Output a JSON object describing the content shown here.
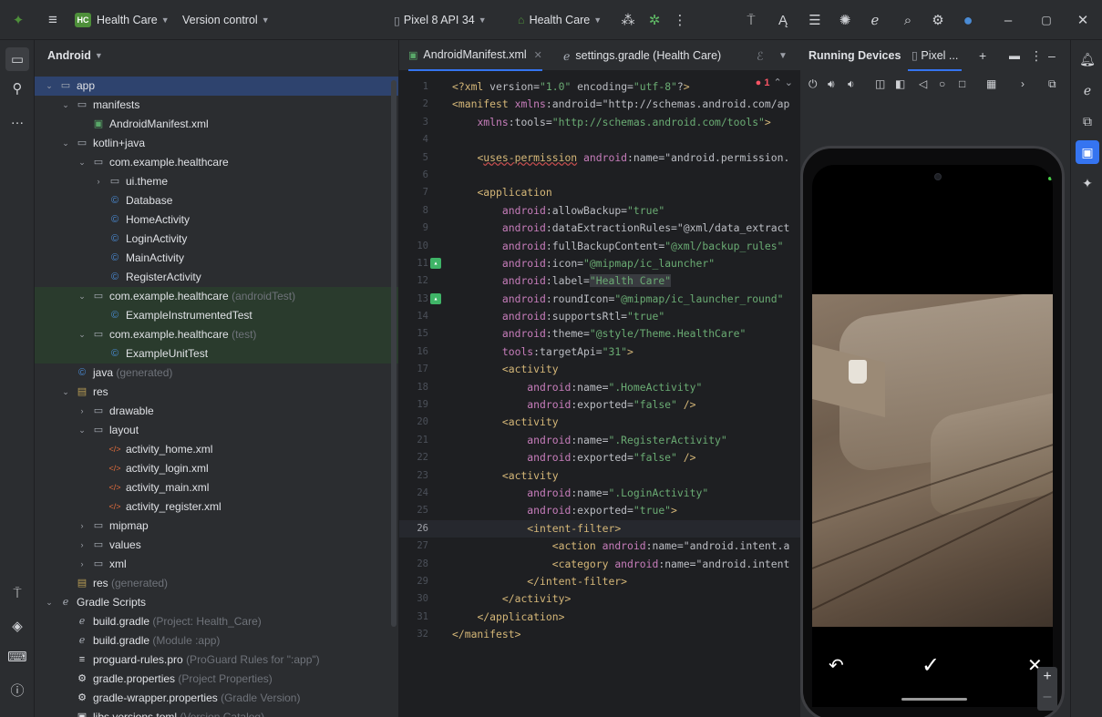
{
  "titlebar": {
    "project_badge": "HC",
    "project_name": "Health Care",
    "vcs": "Version control",
    "device": "Pixel 8 API 34",
    "run_config": "Health Care"
  },
  "project_panel": {
    "view": "Android",
    "tree": [
      {
        "depth": 0,
        "chev": "down",
        "icon": "folder",
        "label": "app",
        "hint": "",
        "selected": true
      },
      {
        "depth": 1,
        "chev": "down",
        "icon": "folder",
        "label": "manifests",
        "hint": ""
      },
      {
        "depth": 2,
        "chev": "",
        "icon": "mani",
        "label": "AndroidManifest.xml",
        "hint": ""
      },
      {
        "depth": 1,
        "chev": "down",
        "icon": "folder",
        "label": "kotlin+java",
        "hint": ""
      },
      {
        "depth": 2,
        "chev": "down",
        "icon": "folder",
        "label": "com.example.healthcare",
        "hint": ""
      },
      {
        "depth": 3,
        "chev": "right",
        "icon": "folder",
        "label": "ui.theme",
        "hint": ""
      },
      {
        "depth": 3,
        "chev": "",
        "icon": "java",
        "label": "Database",
        "hint": ""
      },
      {
        "depth": 3,
        "chev": "",
        "icon": "java",
        "label": "HomeActivity",
        "hint": ""
      },
      {
        "depth": 3,
        "chev": "",
        "icon": "java",
        "label": "LoginActivity",
        "hint": ""
      },
      {
        "depth": 3,
        "chev": "",
        "icon": "java",
        "label": "MainActivity",
        "hint": ""
      },
      {
        "depth": 3,
        "chev": "",
        "icon": "java",
        "label": "RegisterActivity",
        "hint": ""
      },
      {
        "depth": 2,
        "chev": "down",
        "icon": "folder",
        "label": "com.example.healthcare",
        "hint": "(androidTest)",
        "green": true
      },
      {
        "depth": 3,
        "chev": "",
        "icon": "java",
        "label": "ExampleInstrumentedTest",
        "hint": "",
        "green": true
      },
      {
        "depth": 2,
        "chev": "down",
        "icon": "folder",
        "label": "com.example.healthcare",
        "hint": "(test)",
        "green": true
      },
      {
        "depth": 3,
        "chev": "",
        "icon": "java",
        "label": "ExampleUnitTest",
        "hint": "",
        "green": true
      },
      {
        "depth": 1,
        "chev": "",
        "icon": "java",
        "label": "java",
        "hint": "(generated)"
      },
      {
        "depth": 1,
        "chev": "down",
        "icon": "res",
        "label": "res",
        "hint": ""
      },
      {
        "depth": 2,
        "chev": "right",
        "icon": "folder",
        "label": "drawable",
        "hint": ""
      },
      {
        "depth": 2,
        "chev": "down",
        "icon": "folder",
        "label": "layout",
        "hint": ""
      },
      {
        "depth": 3,
        "chev": "",
        "icon": "xml",
        "label": "activity_home.xml",
        "hint": ""
      },
      {
        "depth": 3,
        "chev": "",
        "icon": "xml",
        "label": "activity_login.xml",
        "hint": ""
      },
      {
        "depth": 3,
        "chev": "",
        "icon": "xml",
        "label": "activity_main.xml",
        "hint": ""
      },
      {
        "depth": 3,
        "chev": "",
        "icon": "xml",
        "label": "activity_register.xml",
        "hint": ""
      },
      {
        "depth": 2,
        "chev": "right",
        "icon": "folder",
        "label": "mipmap",
        "hint": ""
      },
      {
        "depth": 2,
        "chev": "right",
        "icon": "folder",
        "label": "values",
        "hint": ""
      },
      {
        "depth": 2,
        "chev": "right",
        "icon": "folder",
        "label": "xml",
        "hint": ""
      },
      {
        "depth": 1,
        "chev": "",
        "icon": "res",
        "label": "res",
        "hint": "(generated)"
      },
      {
        "depth": 0,
        "chev": "down",
        "icon": "gradle",
        "label": "Gradle Scripts",
        "hint": ""
      },
      {
        "depth": 1,
        "chev": "",
        "icon": "gradle",
        "label": "build.gradle",
        "hint": "(Project: Health_Care)"
      },
      {
        "depth": 1,
        "chev": "",
        "icon": "gradle",
        "label": "build.gradle",
        "hint": "(Module :app)"
      },
      {
        "depth": 1,
        "chev": "",
        "icon": "lines",
        "label": "proguard-rules.pro",
        "hint": "(ProGuard Rules for \":app\")"
      },
      {
        "depth": 1,
        "chev": "",
        "icon": "gear",
        "label": "gradle.properties",
        "hint": "(Project Properties)"
      },
      {
        "depth": 1,
        "chev": "",
        "icon": "gear",
        "label": "gradle-wrapper.properties",
        "hint": "(Gradle Version)"
      },
      {
        "depth": 1,
        "chev": "",
        "icon": "toml",
        "label": "libs.versions.toml",
        "hint": "(Version Catalog)"
      }
    ]
  },
  "editor": {
    "tabs": [
      {
        "label": "AndroidManifest.xml",
        "active": true
      },
      {
        "label": "settings.gradle (Health Care)",
        "active": false
      }
    ],
    "error_count": "1",
    "current_line": 26,
    "lines": [
      "<?xml version=\"1.0\" encoding=\"utf-8\"?>",
      "<manifest xmlns:android=\"http://schemas.android.com/ap",
      "    xmlns:tools=\"http://schemas.android.com/tools\">",
      "",
      "    <uses-permission android:name=\"android.permission.",
      "",
      "    <application",
      "        android:allowBackup=\"true\"",
      "        android:dataExtractionRules=\"@xml/data_extract",
      "        android:fullBackupContent=\"@xml/backup_rules\"",
      "        android:icon=\"@mipmap/ic_launcher\"",
      "        android:label=\"Health Care\"",
      "        android:roundIcon=\"@mipmap/ic_launcher_round\"",
      "        android:supportsRtl=\"true\"",
      "        android:theme=\"@style/Theme.HealthCare\"",
      "        tools:targetApi=\"31\">",
      "        <activity",
      "            android:name=\".HomeActivity\"",
      "            android:exported=\"false\" />",
      "        <activity",
      "            android:name=\".RegisterActivity\"",
      "            android:exported=\"false\" />",
      "        <activity",
      "            android:name=\".LoginActivity\"",
      "            android:exported=\"true\">",
      "            <intent-filter>",
      "                <action android:name=\"android.intent.a",
      "                <category android:name=\"android.intent",
      "            </intent-filter>",
      "        </activity>",
      "    </application>",
      "</manifest>"
    ]
  },
  "devices": {
    "title": "Running Devices",
    "device_tab": "Pixel ..."
  },
  "colors": {
    "accent": "#3574f0",
    "bg": "#1e1f22",
    "panel": "#2b2d30"
  }
}
